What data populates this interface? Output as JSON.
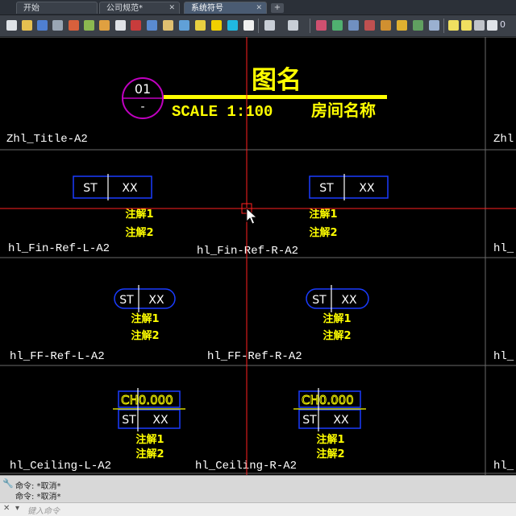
{
  "tabs": [
    {
      "label": "开始",
      "closable": false,
      "active": false
    },
    {
      "label": "公司规范*",
      "closable": true,
      "active": false
    },
    {
      "label": "系统符号",
      "closable": true,
      "active": true
    }
  ],
  "tab_add": "+",
  "toolbar": {
    "readout": "0"
  },
  "canvas": {
    "title_block": {
      "number": "01",
      "sub": "-",
      "title": "图名",
      "scale": "SCALE 1:100",
      "room": "房间名称"
    },
    "labels": {
      "title": "Zhl_Title-A2",
      "title_right": "Zhl",
      "fin_l": "hl_Fin-Ref-L-A2",
      "fin_r": "hl_Fin-Ref-R-A2",
      "fin_right": "hl_",
      "ff_l": "hl_FF-Ref-L-A2",
      "ff_r": "hl_FF-Ref-R-A2",
      "ff_right": "hl_",
      "ceil_l": "hl_Ceiling-L-A2",
      "ceil_r": "hl_Ceiling-R-A2",
      "ceil_right": "hl_"
    },
    "tag_left": "ST",
    "tag_right": "XX",
    "note1": "注解1",
    "note2": "注解2",
    "ceiling_height": "CH0.000"
  },
  "colors": {
    "crosshair": "#ff2020",
    "annotation": "#ffff00",
    "tag_border": "#1a3cff",
    "circle": "#c000c0",
    "tag_text": "#ffffff",
    "label": "#ffffff"
  },
  "command": {
    "history": [
      "命令: *取消*",
      "命令: *取消*"
    ],
    "placeholder": "键入命令"
  }
}
